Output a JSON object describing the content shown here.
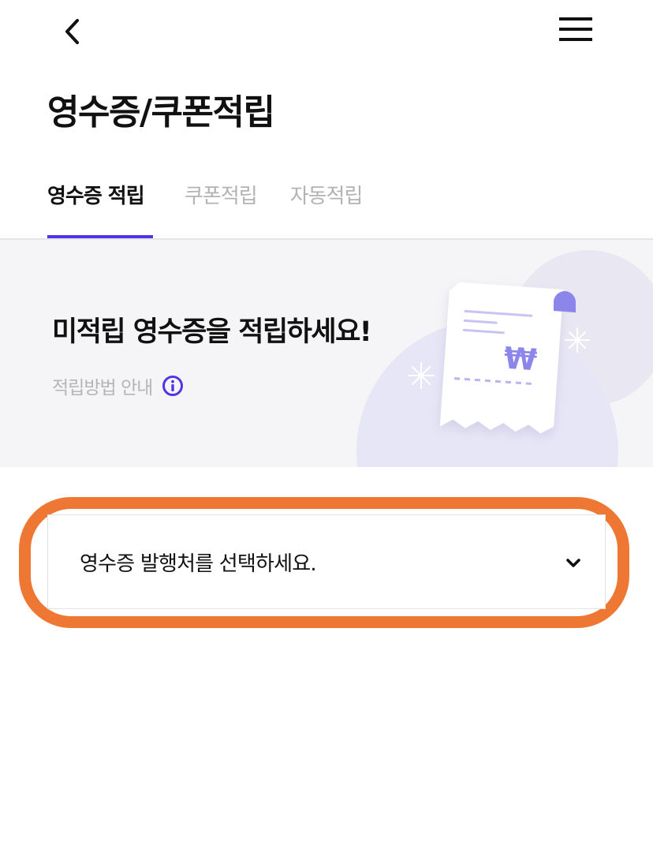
{
  "header": {
    "back_icon": "chevron-left-icon",
    "menu_icon": "hamburger-menu-icon"
  },
  "page": {
    "title": "영수증/쿠폰적립"
  },
  "tabs": [
    {
      "label": "영수증 적립",
      "active": true
    },
    {
      "label": "쿠폰적립",
      "active": false
    },
    {
      "label": "자동적립",
      "active": false
    }
  ],
  "banner": {
    "headline": "미적립 영수증을 적립하세요!",
    "guide_label": "적립방법 안내",
    "guide_icon": "info-icon",
    "receipt_currency": "₩"
  },
  "issuer_select": {
    "label": "영수증 발행처를 선택하세요.",
    "icon": "chevron-down-icon"
  },
  "colors": {
    "accent": "#4f35e6",
    "highlight": "#ee7733",
    "banner_bg": "#f5f5f7",
    "illustration_purple": "#8d86ea"
  }
}
